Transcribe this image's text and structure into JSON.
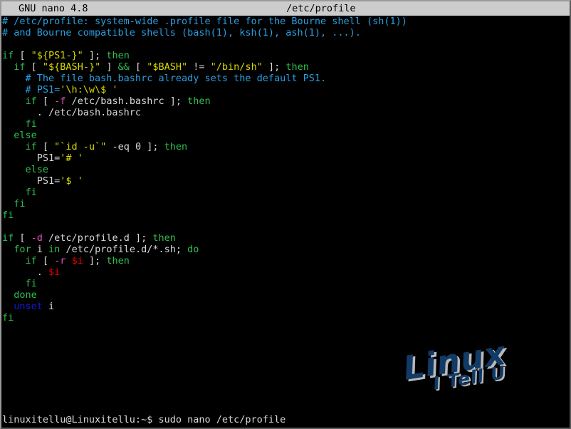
{
  "titlebar": {
    "app": "GNU nano 4.8",
    "filename": "/etc/profile"
  },
  "colors": {
    "background": "#000000",
    "titlebar_bg": "#cccccc",
    "titlebar_fg": "#000000",
    "white": "#d8d8d8",
    "green": "#2fbf4f",
    "yellow": "#d8d800",
    "cyan": "#2a9fe0",
    "magenta": "#e050c0",
    "red": "#e00000",
    "blue": "#1818d8",
    "watermark_navy": "#113a66",
    "watermark_shadow": "#b9b9b9"
  },
  "editor": {
    "lines": [
      [
        {
          "t": "# /etc/profile: system-wide .profile file for the Bourne shell (sh(1))",
          "c": "cyan"
        }
      ],
      [
        {
          "t": "# and Bourne compatible shells (bash(1), ksh(1), ash(1), ...).",
          "c": "cyan"
        }
      ],
      [
        {
          "t": "",
          "c": "white"
        }
      ],
      [
        {
          "t": "if",
          "c": "green"
        },
        {
          "t": " [ ",
          "c": "white"
        },
        {
          "t": "\"${PS1-}\"",
          "c": "yellow"
        },
        {
          "t": " ]; ",
          "c": "white"
        },
        {
          "t": "then",
          "c": "green"
        }
      ],
      [
        {
          "t": "  ",
          "c": "white"
        },
        {
          "t": "if",
          "c": "green"
        },
        {
          "t": " [ ",
          "c": "white"
        },
        {
          "t": "\"${BASH-}\"",
          "c": "yellow"
        },
        {
          "t": " ] ",
          "c": "white"
        },
        {
          "t": "&&",
          "c": "green"
        },
        {
          "t": " [ ",
          "c": "white"
        },
        {
          "t": "\"$BASH\"",
          "c": "yellow"
        },
        {
          "t": " != ",
          "c": "white"
        },
        {
          "t": "\"/bin/sh\"",
          "c": "yellow"
        },
        {
          "t": " ]; ",
          "c": "white"
        },
        {
          "t": "then",
          "c": "green"
        }
      ],
      [
        {
          "t": "    # The file bash.bashrc already sets the default PS1.",
          "c": "cyan"
        }
      ],
      [
        {
          "t": "    # PS1=",
          "c": "cyan"
        },
        {
          "t": "'\\h:\\w\\$ '",
          "c": "yellow"
        }
      ],
      [
        {
          "t": "    ",
          "c": "white"
        },
        {
          "t": "if",
          "c": "green"
        },
        {
          "t": " [ ",
          "c": "white"
        },
        {
          "t": "-f",
          "c": "magenta"
        },
        {
          "t": " /etc/bash.bashrc ]; ",
          "c": "white"
        },
        {
          "t": "then",
          "c": "green"
        }
      ],
      [
        {
          "t": "      . /etc/bash.bashrc",
          "c": "white"
        }
      ],
      [
        {
          "t": "    ",
          "c": "white"
        },
        {
          "t": "fi",
          "c": "green"
        }
      ],
      [
        {
          "t": "  ",
          "c": "white"
        },
        {
          "t": "else",
          "c": "green"
        }
      ],
      [
        {
          "t": "    ",
          "c": "white"
        },
        {
          "t": "if",
          "c": "green"
        },
        {
          "t": " [ ",
          "c": "white"
        },
        {
          "t": "\"`id -u`\"",
          "c": "yellow"
        },
        {
          "t": " -eq 0 ]; ",
          "c": "white"
        },
        {
          "t": "then",
          "c": "green"
        }
      ],
      [
        {
          "t": "      PS1=",
          "c": "white"
        },
        {
          "t": "'# '",
          "c": "yellow"
        }
      ],
      [
        {
          "t": "    ",
          "c": "white"
        },
        {
          "t": "else",
          "c": "green"
        }
      ],
      [
        {
          "t": "      PS1=",
          "c": "white"
        },
        {
          "t": "'$ '",
          "c": "yellow"
        }
      ],
      [
        {
          "t": "    ",
          "c": "white"
        },
        {
          "t": "fi",
          "c": "green"
        }
      ],
      [
        {
          "t": "  ",
          "c": "white"
        },
        {
          "t": "fi",
          "c": "green"
        }
      ],
      [
        {
          "t": "fi",
          "c": "green"
        }
      ],
      [
        {
          "t": "",
          "c": "white"
        }
      ],
      [
        {
          "t": "if",
          "c": "green"
        },
        {
          "t": " [ ",
          "c": "white"
        },
        {
          "t": "-d",
          "c": "magenta"
        },
        {
          "t": " /etc/profile.d ]; ",
          "c": "white"
        },
        {
          "t": "then",
          "c": "green"
        }
      ],
      [
        {
          "t": "  ",
          "c": "white"
        },
        {
          "t": "for",
          "c": "green"
        },
        {
          "t": " i ",
          "c": "white"
        },
        {
          "t": "in",
          "c": "green"
        },
        {
          "t": " /etc/profile.d/*.sh; ",
          "c": "white"
        },
        {
          "t": "do",
          "c": "green"
        }
      ],
      [
        {
          "t": "    ",
          "c": "white"
        },
        {
          "t": "if",
          "c": "green"
        },
        {
          "t": " [ ",
          "c": "white"
        },
        {
          "t": "-r",
          "c": "magenta"
        },
        {
          "t": " ",
          "c": "white"
        },
        {
          "t": "$i",
          "c": "red"
        },
        {
          "t": " ]; ",
          "c": "white"
        },
        {
          "t": "then",
          "c": "green"
        }
      ],
      [
        {
          "t": "      . ",
          "c": "white"
        },
        {
          "t": "$i",
          "c": "red"
        }
      ],
      [
        {
          "t": "    ",
          "c": "white"
        },
        {
          "t": "fi",
          "c": "green"
        }
      ],
      [
        {
          "t": "  ",
          "c": "white"
        },
        {
          "t": "done",
          "c": "green"
        }
      ],
      [
        {
          "t": "  ",
          "c": "white"
        },
        {
          "t": "unset",
          "c": "blue"
        },
        {
          "t": " i",
          "c": "white"
        }
      ],
      [
        {
          "t": "fi",
          "c": "green"
        }
      ]
    ]
  },
  "prompt": {
    "text": "linuxitellu@Linuxitellu:~$ sudo nano /etc/profile"
  },
  "watermark": {
    "line1": "Linux",
    "line2": "I Tell U"
  }
}
